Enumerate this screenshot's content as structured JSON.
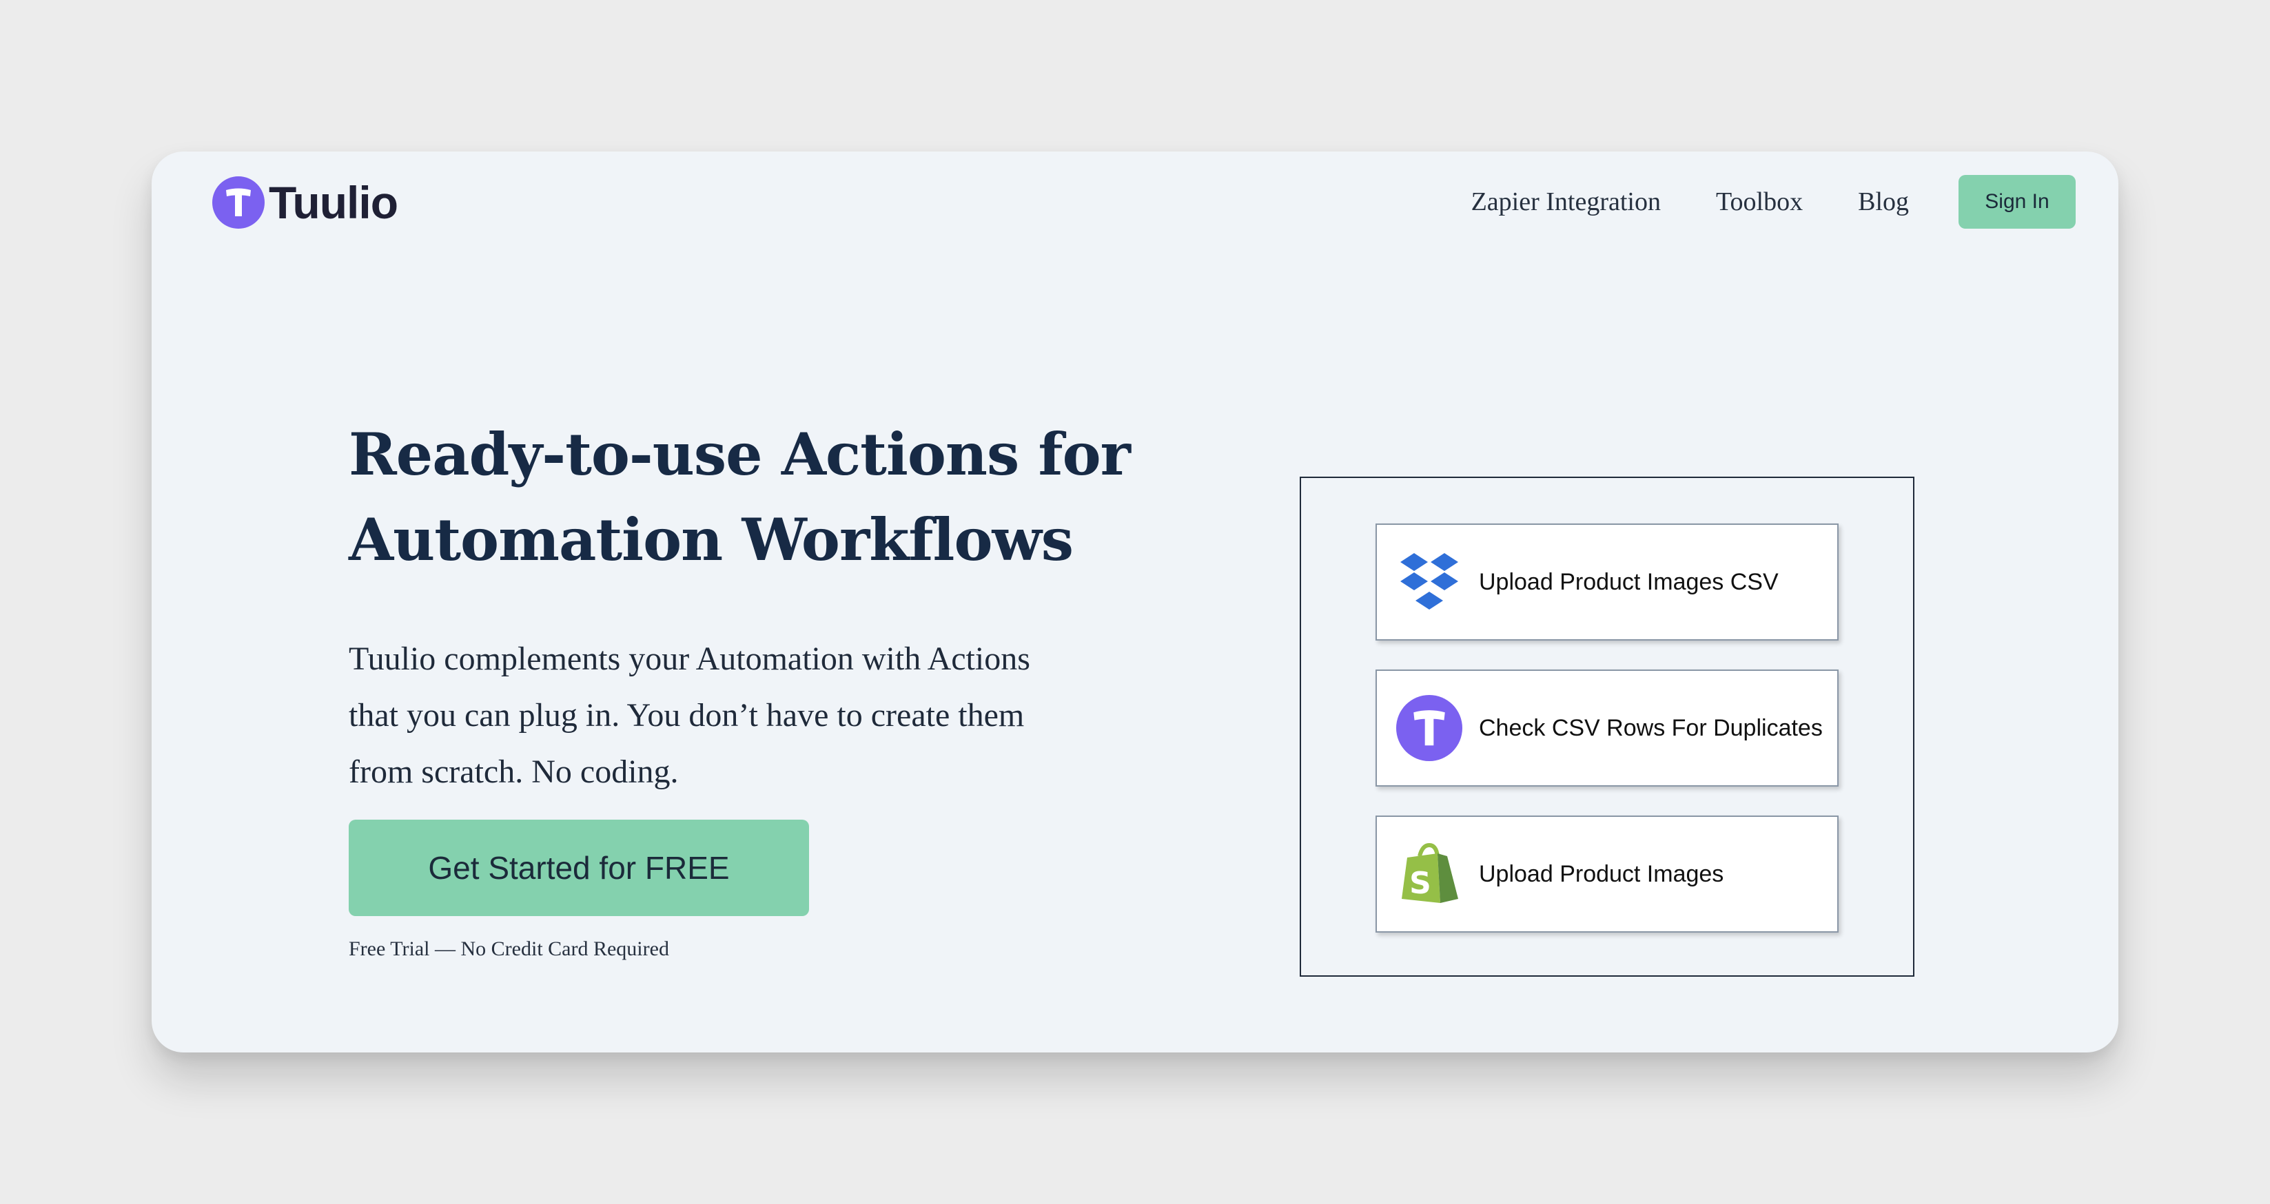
{
  "brand": {
    "name": "Tuulio",
    "color": "#7b61f0"
  },
  "nav": {
    "links": [
      "Zapier Integration",
      "Toolbox",
      "Blog"
    ],
    "sign_in": "Sign In"
  },
  "hero": {
    "headline": "Ready-to-use Actions for Automation Workflows",
    "subtext": "Tuulio complements your Automation with Actions that you can plug in. You don’t have to create them from scratch. No coding.",
    "cta": "Get Started for FREE",
    "fineprint": "Free Trial — No Credit Card Required"
  },
  "actions": [
    {
      "label": "Upload Product Images CSV",
      "icon": "dropbox-icon"
    },
    {
      "label": "Check CSV Rows For Duplicates",
      "icon": "tuulio-icon"
    },
    {
      "label": "Upload Product Images",
      "icon": "shopify-icon"
    }
  ],
  "colors": {
    "accent": "#84d1ae",
    "heading": "#172a45",
    "dropbox": "#2f6fd8",
    "shopify": "#95bf47"
  }
}
